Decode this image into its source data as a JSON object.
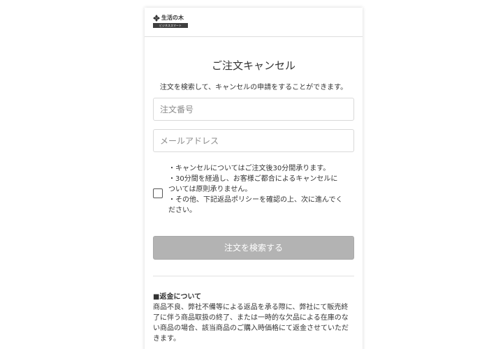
{
  "brand": {
    "logo_text": "生活の木",
    "logo_tagline": "ビジネススマート",
    "logo_icon": "leaf-emblem-icon"
  },
  "form": {
    "title": "ご注文キャンセル",
    "description": "注文を検索して、キャンセルの申請をすることができます。",
    "order_number_placeholder": "注文番号",
    "order_number_value": "",
    "email_placeholder": "メールアドレス",
    "email_value": "",
    "agreement_checked": false,
    "notes": [
      "・キャンセルについてはご注文後30分間承ります。",
      "・30分間を経過し、お客様ご都合によるキャンセルに",
      "ついては原則承りません。",
      "・その他、下記返品ポリシーを確認の上、次に進んでく",
      "ださい。"
    ],
    "search_button_label": "注文を検索する",
    "search_button_color": "#b3b3b3"
  },
  "refund": {
    "heading": "■返金について",
    "lines": [
      "商品不良、弊社不備等による返品を承る際に、弊社にて販売終",
      "了に伴う商品取扱の終了、または一時的な欠品による在庫のな",
      "い商品の場合、該当商品のご購入時価格にて返金させていただ",
      "きます。"
    ]
  }
}
